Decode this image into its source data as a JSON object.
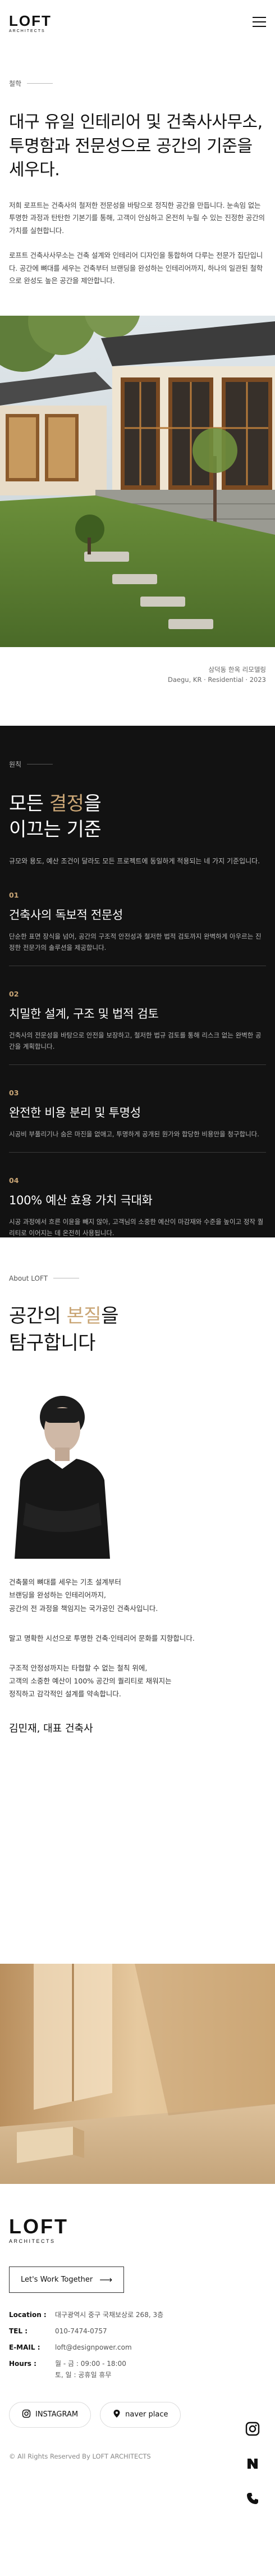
{
  "header": {
    "logo_main": "LOFT",
    "logo_sub": "ARCHITECTS",
    "menu_icon": "hamburger-menu-icon"
  },
  "philosophy": {
    "label": "철학",
    "title": "대구 유일 인테리어 및 건축사사무소, 투명함과 전문성으로 공간의 기준을 세우다.",
    "p1": "저희 로프트는 건축사의 철저한 전문성을 바탕으로 정직한 공간을 만듭니다. 눈속임 없는 투명한 과정과 탄탄한 기본기를 통해, 고객이 안심하고 온전히 누릴 수 있는 진정한 공간의 가치를 실현합니다.",
    "p2": "로프트 건축사사무소는 건축 설계와 인테리어 디자인을 통합하여 다루는 전문가 집단입니다. 공간에 뼈대를 세우는 건축부터 브랜딩을 완성하는 인테리어까지, 하나의 일관된 철학으로 완성도 높은 공간을 제안합니다.",
    "caption_line1": "삼덕동 한옥 리모델링",
    "caption_line2": "Daegu, KR · Residential · 2023"
  },
  "principles": {
    "label": "원칙",
    "title_pre": "모든 ",
    "title_accent": "결정",
    "title_post": "을",
    "title_line2": "이끄는 기준",
    "lead": "규모와 용도, 예산 조건이 달라도 모든 프로젝트에 동일하게 적용되는 네 가지 기준입니다.",
    "items": [
      {
        "num": "01",
        "title": "건축사의 독보적 전문성",
        "desc": "단순한 표면 장식을 넘어, 공간의 구조적 안전성과 철저한 법적 검토까지 완벽하게 아우르는 진정한 전문가의 솔루션을 제공합니다."
      },
      {
        "num": "02",
        "title": "치밀한 설계, 구조 및 법적 검토",
        "desc": "건축사의 전문성을 바탕으로 안전을 보장하고, 철저한 법규 검토를 통해 리스크 없는 완벽한 공간을 계획합니다."
      },
      {
        "num": "03",
        "title": "완전한 비용 분리 및 투명성",
        "desc": "시공비 부풀리기나 숨은 마진을 없애고, 투명하게 공개된 원가와 합당한 비용만을 청구합니다."
      },
      {
        "num": "04",
        "title": "100% 예산 효용 가치 극대화",
        "desc": "시공 과정에서 흐른 이윤을 빼지 않아, 고객님의 소중한 예산이 마감재와 수준을 높이고 정작 퀄리티로 이어지는 데 온전히 사용됩니다."
      }
    ]
  },
  "about": {
    "label": "About LOFT",
    "title_pre": "공간의 ",
    "title_accent": "본질",
    "title_post": "을",
    "title_line2": "탐구합니다",
    "p1": "건축물의 뼈대를 세우는 기초 설계부터\n브랜딩을 완성하는 인테리어까지,\n공간의 전 과정을 책임지는 국가공인 건축사입니다.",
    "p2": "말고 명확한 시선으로 투명한 건축·인테리어 문화를 지향합니다.",
    "p3": "구조적 안정성까지는 타협할 수 없는 철칙 위에,\n고객의 소중한 예산이 100% 공간의 퀄리티로 채워지는\n정직하고 감각적인 설계를 약속합니다.",
    "signature": "김민재, 대표 건축사"
  },
  "footer": {
    "logo_main": "LOFT",
    "logo_sub": "ARCHITECTS",
    "talk_label": "Let's Work Together",
    "rows": [
      {
        "k": "Location :",
        "v": "대구광역시 중구 국채보상로 268, 3층"
      },
      {
        "k": "TEL :",
        "v": "010-7474-0757"
      },
      {
        "k": "E-MAIL :",
        "v": "loft@designpower.com"
      },
      {
        "k": "Hours :",
        "v": "월 - 금 : 09:00 - 18:00\n토, 일 : 공휴일 휴무"
      }
    ],
    "instagram_label": "INSTAGRAM",
    "naver_label": "naver place",
    "copyright": "© All Rights Reserved By LOFT ARCHITECTS"
  },
  "colors": {
    "accent": "#c9a575",
    "dark_bg": "#121212"
  }
}
